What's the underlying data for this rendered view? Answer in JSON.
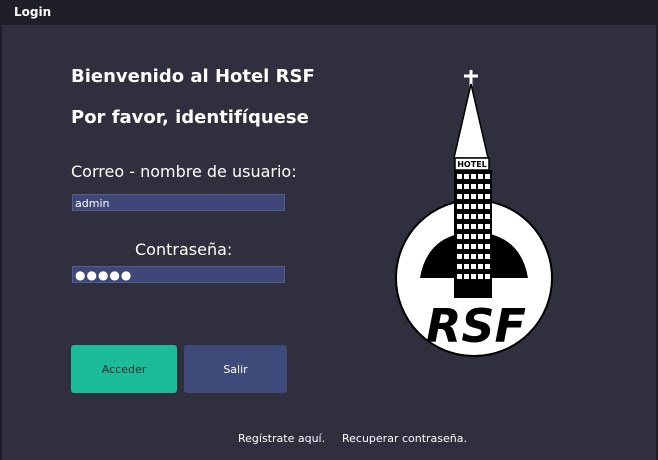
{
  "window": {
    "title": "Login"
  },
  "main": {
    "welcome": "Bienvenido al Hotel RSF",
    "prompt": "Por favor, identifíquese",
    "user_label": "Correo - nombre de usuario:",
    "user_value": "admin",
    "password_label": "Contraseña:",
    "password_value": "●●●●●",
    "login_button": "Acceder",
    "exit_button": "Salir",
    "register_link": "Regístrate aquí.",
    "recover_link": "Recuperar contraseña."
  },
  "logo": {
    "sign": "HOTEL",
    "text": "RSF"
  },
  "colors": {
    "background": "#2f2f3d",
    "titlebar": "#1f1f2a",
    "field": "#3f4778",
    "accent_login": "#1bbc9a",
    "accent_exit": "#3d4a7a"
  }
}
